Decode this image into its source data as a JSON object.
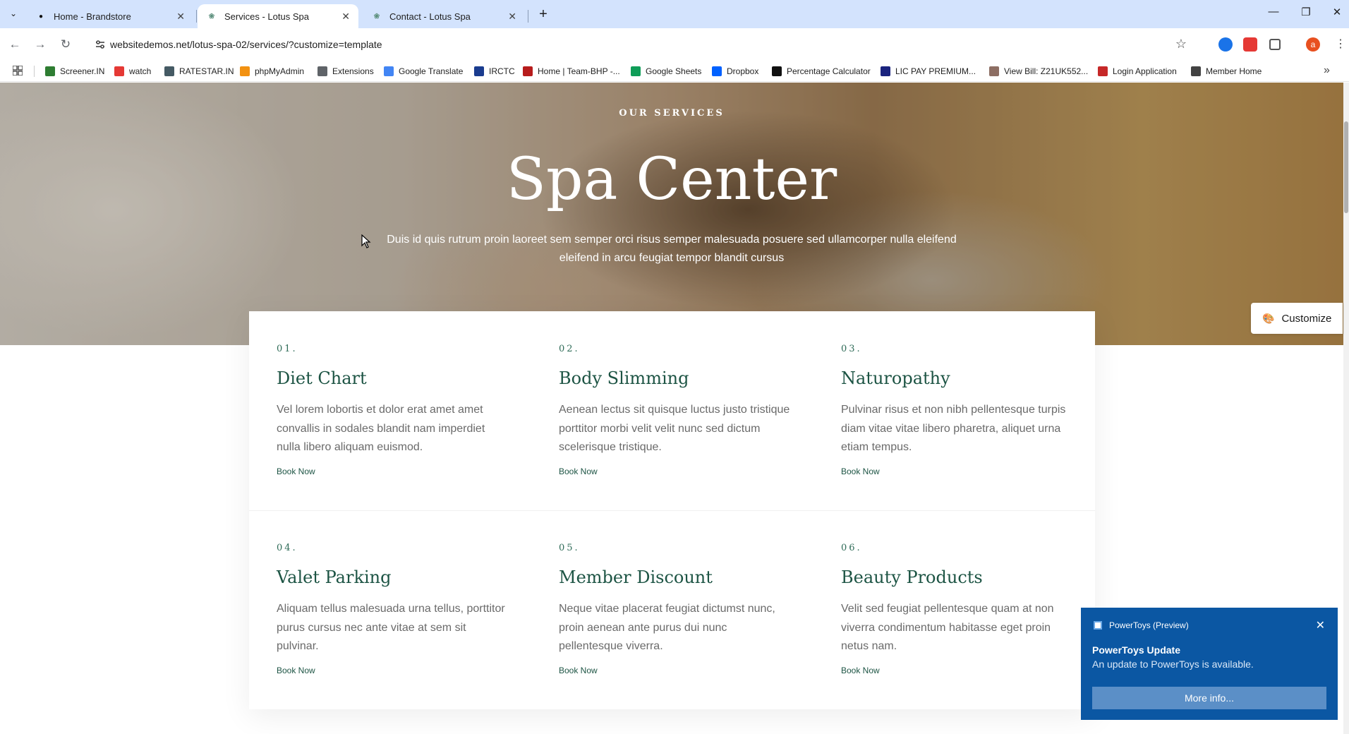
{
  "browser": {
    "tabs": [
      {
        "title": "Home - Brandstore",
        "icon": "brandstore-favicon"
      },
      {
        "title": "Services - Lotus Spa",
        "icon": "lotus-favicon"
      },
      {
        "title": "Contact - Lotus Spa",
        "icon": "lotus-favicon"
      }
    ],
    "url": "websitedemos.net/lotus-spa-02/services/?customize=template",
    "profile_initial": "a",
    "bookmarks": [
      {
        "label": "Screener.IN",
        "color": "#2e7d32"
      },
      {
        "label": "watch",
        "color": "#e53935"
      },
      {
        "label": "RATESTAR.IN",
        "color": "#455a64"
      },
      {
        "label": "phpMyAdmin",
        "color": "#f29111"
      },
      {
        "label": "Extensions",
        "color": "#5f6368"
      },
      {
        "label": "Google Translate",
        "color": "#4285f4"
      },
      {
        "label": "IRCTC",
        "color": "#1a3c8f"
      },
      {
        "label": "Home | Team-BHP -...",
        "color": "#b71c1c"
      },
      {
        "label": "Google Sheets",
        "color": "#0f9d58"
      },
      {
        "label": "Dropbox",
        "color": "#0061ff"
      },
      {
        "label": "Percentage Calculator",
        "color": "#111111"
      },
      {
        "label": "LIC PAY PREMIUM...",
        "color": "#1a237e"
      },
      {
        "label": "View Bill: Z21UK552...",
        "color": "#8d6e63"
      },
      {
        "label": "Login Application",
        "color": "#c62828"
      },
      {
        "label": "Member Home",
        "color": "#424242"
      }
    ]
  },
  "hero": {
    "kicker": "OUR SERVICES",
    "title": "Spa Center",
    "description": "Duis id quis rutrum proin laoreet sem semper orci risus semper malesuada posuere sed ullamcorper nulla eleifend eleifend in arcu feugiat tempor blandit cursus"
  },
  "customize": {
    "label": "Customize"
  },
  "services": [
    {
      "num": "01.",
      "title": "Diet Chart",
      "desc": "Vel lorem lobortis et dolor erat amet amet convallis in sodales blandit nam imperdiet nulla libero aliquam euismod.",
      "link": "Book Now"
    },
    {
      "num": "02.",
      "title": "Body Slimming",
      "desc": "Aenean lectus sit quisque luctus justo tristique porttitor morbi velit velit nunc sed dictum scelerisque tristique.",
      "link": "Book Now"
    },
    {
      "num": "03.",
      "title": "Naturopathy",
      "desc": "Pulvinar risus et non nibh pellentesque turpis diam vitae vitae libero pharetra, aliquet urna etiam tempus.",
      "link": "Book Now"
    },
    {
      "num": "04.",
      "title": "Valet Parking",
      "desc": "Aliquam tellus malesuada urna tellus, porttitor purus cursus nec ante vitae at sem sit pulvinar.",
      "link": "Book Now"
    },
    {
      "num": "05.",
      "title": "Member Discount",
      "desc": "Neque vitae placerat feugiat dictumst nunc, proin aenean ante purus dui nunc pellentesque viverra.",
      "link": "Book Now"
    },
    {
      "num": "06.",
      "title": "Beauty Products",
      "desc": "Velit sed feugiat pellentesque quam at non viverra condimentum habitasse eget proin netus nam.",
      "link": "Book Now"
    }
  ],
  "toast": {
    "app": "PowerToys (Preview)",
    "title": "PowerToys Update",
    "body": "An update to PowerToys is available.",
    "button": "More info..."
  },
  "colors": {
    "accent": "#1d5444",
    "tabbar": "#d3e3fd",
    "toast": "#0b57a3"
  }
}
